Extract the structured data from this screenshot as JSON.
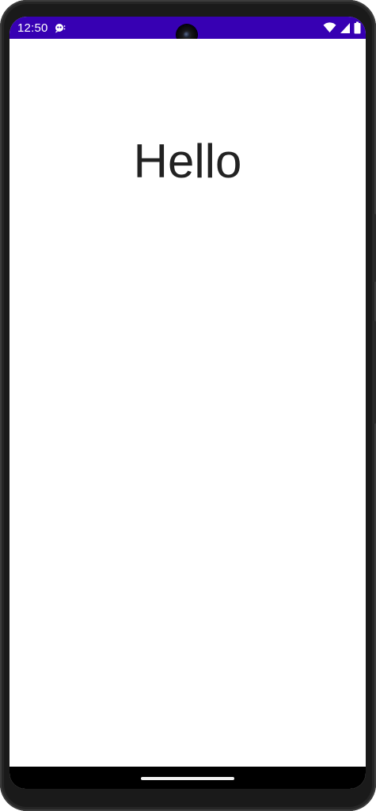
{
  "status_bar": {
    "time": "12:50",
    "background_color": "#3700b3",
    "icons": [
      "notification-icon",
      "wifi-icon",
      "cellular-signal-icon",
      "battery-icon"
    ]
  },
  "main": {
    "text": "Hello"
  },
  "navigation": {
    "handle": "home-gesture-handle"
  }
}
